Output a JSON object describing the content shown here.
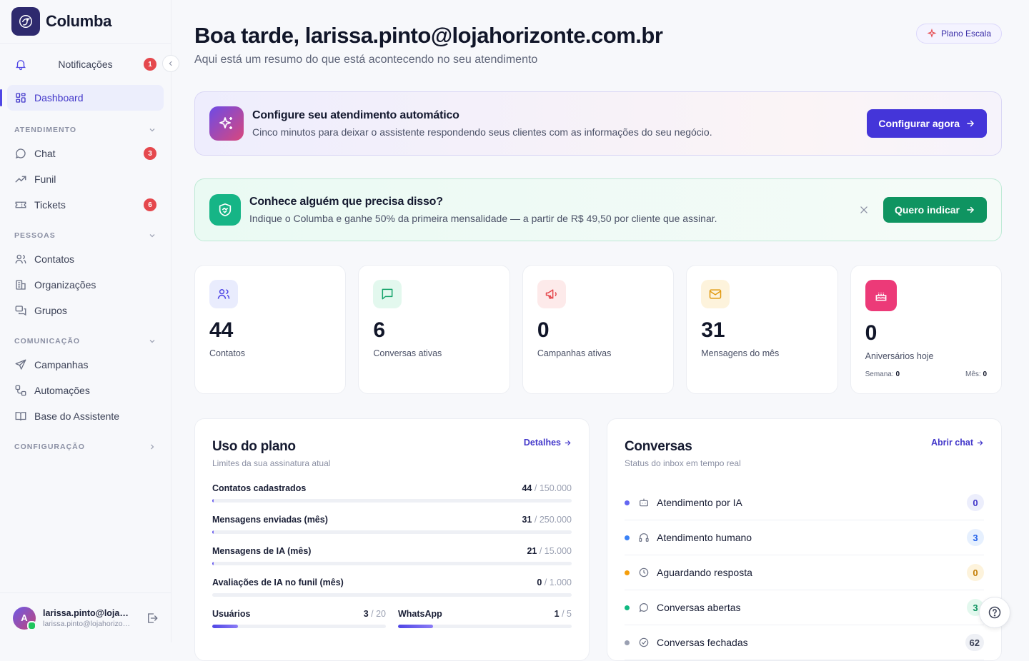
{
  "app": {
    "name": "Columba"
  },
  "sidebar": {
    "notifications": {
      "label": "Notificações",
      "count": "1"
    },
    "dashboard": "Dashboard",
    "sections": [
      {
        "title": "ATENDIMENTO",
        "items": [
          {
            "label": "Chat",
            "icon": "chat-bubble-icon",
            "count": "3"
          },
          {
            "label": "Funil",
            "icon": "trend-icon"
          },
          {
            "label": "Tickets",
            "icon": "ticket-icon",
            "count": "6"
          }
        ]
      },
      {
        "title": "PESSOAS",
        "items": [
          {
            "label": "Contatos",
            "icon": "users-icon"
          },
          {
            "label": "Organizações",
            "icon": "building-icon"
          },
          {
            "label": "Grupos",
            "icon": "groups-icon"
          }
        ]
      },
      {
        "title": "COMUNICAÇÃO",
        "items": [
          {
            "label": "Campanhas",
            "icon": "send-icon"
          },
          {
            "label": "Automações",
            "icon": "workflow-icon"
          },
          {
            "label": "Base do Assistente",
            "icon": "book-icon"
          }
        ]
      },
      {
        "title": "CONFIGURAÇÃO",
        "items": []
      }
    ],
    "user": {
      "initial": "A",
      "name": "larissa.pinto@lojahorizonte.com.br",
      "email": "larissa.pinto@lojahorizonte.com.br"
    }
  },
  "header": {
    "greeting": "Boa tarde, larissa.pinto@lojahorizonte.com.br",
    "subtitle": "Aqui está um resumo do que está acontecendo no seu atendimento",
    "plan": "Plano Escala"
  },
  "banners": {
    "setup": {
      "title": "Configure seu atendimento automático",
      "desc": "Cinco minutos para deixar o assistente respondendo seus clientes com as informações do seu negócio.",
      "button": "Configurar agora"
    },
    "referral": {
      "title": "Conhece alguém que precisa disso?",
      "desc": "Indique o Columba e ganhe 50% da primeira mensalidade — a partir de R$ 49,50 por cliente que assinar.",
      "button": "Quero indicar"
    }
  },
  "stats": [
    {
      "value": "44",
      "label": "Contatos",
      "icon": "users-icon",
      "bg": "#e9ecfd",
      "color": "#4f46e5"
    },
    {
      "value": "6",
      "label": "Conversas ativas",
      "icon": "message-icon",
      "bg": "#e3f8ee",
      "color": "#16a36b"
    },
    {
      "value": "0",
      "label": "Campanhas ativas",
      "icon": "megaphone-icon",
      "bg": "#fdeaea",
      "color": "#e5484d"
    },
    {
      "value": "31",
      "label": "Mensagens do mês",
      "icon": "mail-icon",
      "bg": "#fdf3dc",
      "color": "#e19a12"
    },
    {
      "value": "0",
      "label": "Aniversários hoje",
      "icon": "cake-icon",
      "bg": "#ec3a78",
      "color": "#ffffff",
      "week_label": "Semana:",
      "week_value": "0",
      "month_label": "Mês:",
      "month_value": "0"
    }
  ],
  "usage": {
    "title": "Uso do plano",
    "subtitle": "Limites da sua assinatura atual",
    "link": "Detalhes",
    "rows": [
      {
        "label": "Contatos cadastrados",
        "used": "44",
        "limit": "150.000",
        "fraction": 0.0003
      },
      {
        "label": "Mensagens enviadas (mês)",
        "used": "31",
        "limit": "250.000",
        "fraction": 0.0001
      },
      {
        "label": "Mensagens de IA (mês)",
        "used": "21",
        "limit": "15.000",
        "fraction": 0.0014
      },
      {
        "label": "Avaliações de IA no funil (mês)",
        "used": "0",
        "limit": "1.000",
        "fraction": 0
      }
    ],
    "pairs": [
      {
        "label": "Usuários",
        "used": "3",
        "limit": "20",
        "fraction": 0.15
      },
      {
        "label": "WhatsApp",
        "used": "1",
        "limit": "5",
        "fraction": 0.2
      }
    ]
  },
  "conversations": {
    "title": "Conversas",
    "subtitle": "Status do inbox em tempo real",
    "link": "Abrir chat",
    "rows": [
      {
        "label": "Atendimento por IA",
        "count": "0",
        "icon": "bot-icon",
        "dot": "#6366f1",
        "bg": "#eceefc",
        "fg": "#4338ca"
      },
      {
        "label": "Atendimento humano",
        "count": "3",
        "icon": "headset-icon",
        "dot": "#3b82f6",
        "bg": "#e6f0fe",
        "fg": "#2563eb"
      },
      {
        "label": "Aguardando resposta",
        "count": "0",
        "icon": "clock-icon",
        "dot": "#f59e0b",
        "bg": "#fdf3dc",
        "fg": "#c47f08"
      },
      {
        "label": "Conversas abertas",
        "count": "3",
        "icon": "chat-bubble-icon",
        "dot": "#10b981",
        "bg": "#e3f8ee",
        "fg": "#0f9461"
      },
      {
        "label": "Conversas fechadas",
        "count": "62",
        "icon": "check-circle-icon",
        "dot": "#9aa0b2",
        "bg": "#eef0f5",
        "fg": "#3c4257"
      }
    ]
  }
}
